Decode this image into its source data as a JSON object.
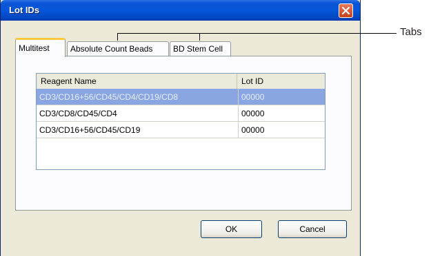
{
  "window": {
    "title": "Lot IDs"
  },
  "tabs": [
    {
      "label": "Multitest",
      "active": true
    },
    {
      "label": "Absolute Count Beads",
      "active": false
    },
    {
      "label": "BD Stem Cell",
      "active": false
    }
  ],
  "table": {
    "columns": [
      "Reagent Name",
      "Lot ID"
    ],
    "rows": [
      {
        "reagent": "CD3/CD16+56/CD45/CD4/CD19/CD8",
        "lot_id": "00000",
        "selected": true
      },
      {
        "reagent": "CD3/CD8/CD45/CD4",
        "lot_id": "00000",
        "selected": false
      },
      {
        "reagent": "CD3/CD16+56/CD45/CD19",
        "lot_id": "00000",
        "selected": false
      }
    ]
  },
  "buttons": {
    "ok": "OK",
    "cancel": "Cancel"
  },
  "callout": {
    "label": "Tabs"
  },
  "icons": {
    "close": "close-icon"
  },
  "colors": {
    "titlebar": "#0556d9",
    "selection": "#8aa6e2",
    "active_tab_accent": "#ffc83c",
    "dialog_bg": "#ece9d8"
  }
}
